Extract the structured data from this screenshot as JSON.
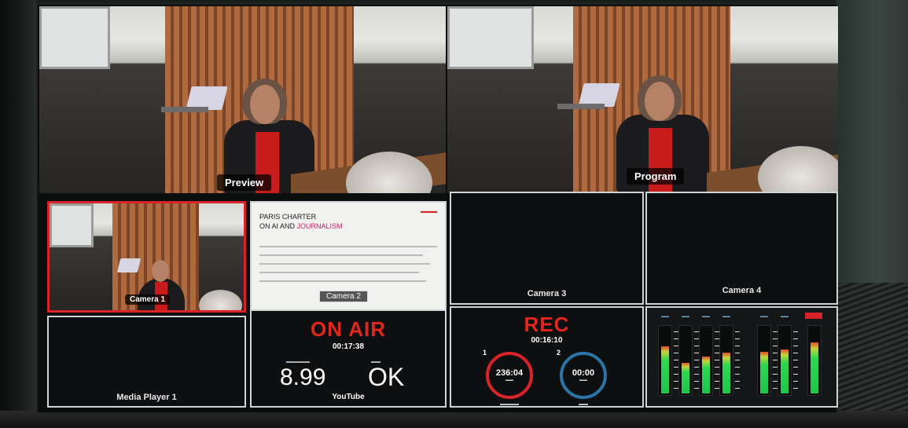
{
  "views": {
    "preview_label": "Preview",
    "program_label": "Program"
  },
  "multiview": {
    "camera1": "Camera 1",
    "camera2": "Camera 2",
    "camera3": "Camera 3",
    "camera4": "Camera 4",
    "media_player": "Media Player 1"
  },
  "slide": {
    "title_line1": "PARIS CHARTER",
    "title_line2_a": "ON AI AND",
    "title_line2_b": "JOURNALISM"
  },
  "stream": {
    "status": "ON AIR",
    "duration": "00:17:38",
    "bitrate_value": "8.99",
    "cache_value": "OK",
    "platform": "YouTube"
  },
  "record": {
    "status": "REC",
    "duration": "00:16:10",
    "disk1_number": "1",
    "disk1_time": "236:04",
    "disk2_number": "2",
    "disk2_time": "00:00"
  },
  "audio": {
    "levels": [
      0.7,
      0.45,
      0.55,
      0.6,
      0.62,
      0.65,
      0.75
    ]
  },
  "colors": {
    "tally_red": "#d9232a",
    "onair_red": "#e3261d",
    "disk2_blue": "#2c74a6",
    "meter_green": "#1fc44b"
  }
}
